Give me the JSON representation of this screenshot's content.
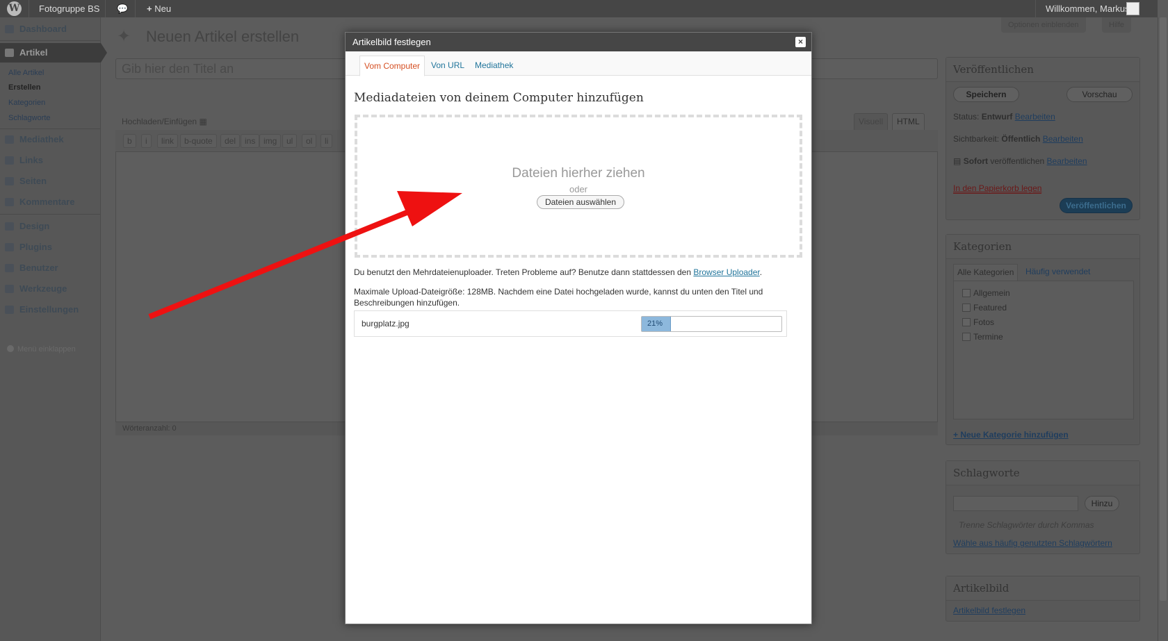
{
  "admin_bar": {
    "site_name": "Fotogruppe BS",
    "new_label": "Neu",
    "welcome": "Willkommen, Markus"
  },
  "screen_options": {
    "options_label": "Optionen einblenden",
    "help_label": "Hilfe"
  },
  "menu": {
    "dashboard": "Dashboard",
    "artikel": "Artikel",
    "sub": [
      "Alle Artikel",
      "Erstellen",
      "Kategorien",
      "Schlagworte"
    ],
    "mediathek": "Mediathek",
    "links": "Links",
    "seiten": "Seiten",
    "kommentare": "Kommentare",
    "design": "Design",
    "plugins": "Plugins",
    "benutzer": "Benutzer",
    "werkzeuge": "Werkzeuge",
    "einstellungen": "Einstellungen",
    "collapse": "Menü einklappen"
  },
  "page": {
    "title": "Neuen Artikel erstellen",
    "title_placeholder": "Gib hier den Titel an"
  },
  "editor": {
    "upload_label": "Hochladen/Einfügen",
    "tab_visual": "Visuell",
    "tab_html": "HTML",
    "buttons": [
      "b",
      "i",
      "link",
      "b-quote",
      "del",
      "ins",
      "img",
      "ul",
      "ol",
      "li"
    ],
    "word_count": "Wörteranzahl: 0"
  },
  "publish": {
    "title": "Veröffentlichen",
    "save": "Speichern",
    "preview": "Vorschau",
    "status_label": "Status:",
    "status_value": "Entwurf",
    "visibility_label": "Sichtbarkeit:",
    "visibility_value": "Öffentlich",
    "schedule_value": "Sofort",
    "schedule_label": "veröffentlichen",
    "edit": "Bearbeiten",
    "trash": "In den Papierkorb legen",
    "publish": "Veröffentlichen"
  },
  "categories": {
    "title": "Kategorien",
    "tab_all": "Alle Kategorien",
    "tab_popular": "Häufig verwendet",
    "items": [
      "Allgemein",
      "Featured",
      "Fotos",
      "Termine"
    ],
    "add_new": "+ Neue Kategorie hinzufügen"
  },
  "tags": {
    "title": "Schlagworte",
    "add": "Hinzu",
    "hint": "Trenne Schlagwörter durch Kommas",
    "choose": "Wähle aus häufig genutzten Schlagwörtern"
  },
  "featured_image": {
    "title": "Artikelbild",
    "set_link": "Artikelbild festlegen"
  },
  "modal": {
    "title": "Artikelbild festlegen",
    "close": "×",
    "tabs": [
      "Vom Computer",
      "Von URL",
      "Mediathek"
    ],
    "heading": "Mediadateien von deinem Computer hinzufügen",
    "drop_text": "Dateien hierher ziehen",
    "or": "oder",
    "select_button": "Dateien auswählen",
    "uploader_note": "Du benutzt den Mehrdateienuploader. Treten Probleme auf? Benutze dann stattdessen den",
    "browser_uploader": "Browser Uploader",
    "max_size": "Maximale Upload-Dateigröße: 128MB. Nachdem eine Datei hochgeladen wurde, kannst du unten den Titel und Beschreibungen hinzufügen.",
    "file_name": "burgplatz.jpg",
    "progress_label": "21%",
    "progress": 0.21
  },
  "colors": {
    "annotation_arrow": "#ee1111",
    "modal_header": "#464646",
    "link": "#21759b",
    "active_tab": "#d54e21"
  }
}
